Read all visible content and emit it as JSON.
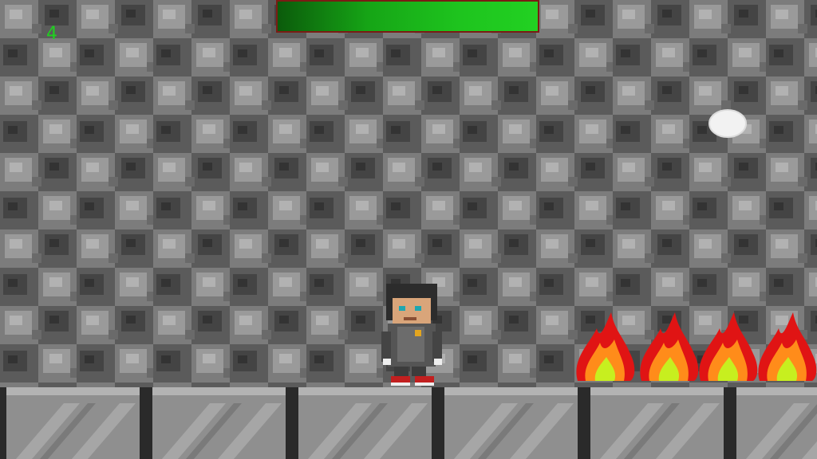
{
  "hud": {
    "score": "4",
    "health_fraction": 1.0,
    "health_color": "#1ec41e"
  },
  "scene": {
    "background": "cobblestone-wall",
    "floor": "stone-block-floor",
    "player": "player-character",
    "projectile": "white-ball",
    "hazards": [
      "fire-hazard",
      "fire-hazard",
      "fire-hazard",
      "fire-hazard"
    ]
  }
}
